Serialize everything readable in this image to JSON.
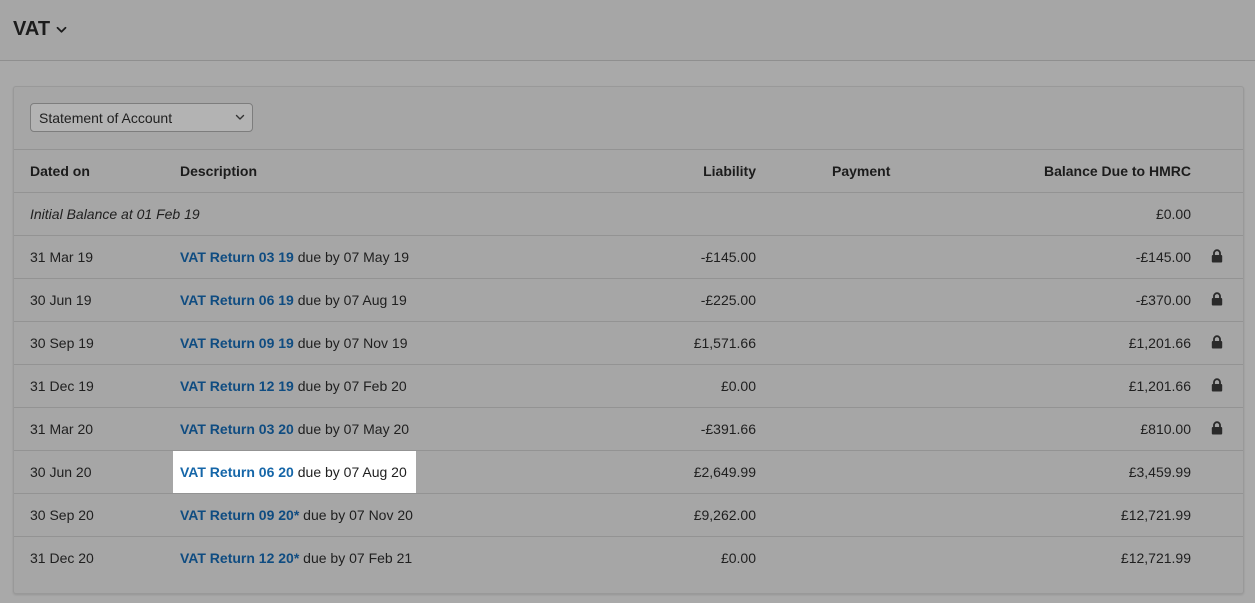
{
  "header": {
    "title": "VAT"
  },
  "filter": {
    "selected": "Statement of Account"
  },
  "table": {
    "columns": {
      "date": "Dated on",
      "description": "Description",
      "liability": "Liability",
      "payment": "Payment",
      "balance": "Balance Due to HMRC"
    },
    "initial": {
      "label": "Initial Balance at 01 Feb 19",
      "balance": "£0.00"
    },
    "rows": [
      {
        "date": "31 Mar 19",
        "link": "VAT Return 03 19",
        "due": " due by 07 May 19",
        "liability": "-£145.00",
        "payment": "",
        "balance": "-£145.00",
        "locked": true
      },
      {
        "date": "30 Jun 19",
        "link": "VAT Return 06 19",
        "due": " due by 07 Aug 19",
        "liability": "-£225.00",
        "payment": "",
        "balance": "-£370.00",
        "locked": true
      },
      {
        "date": "30 Sep 19",
        "link": "VAT Return 09 19",
        "due": " due by 07 Nov 19",
        "liability": "£1,571.66",
        "payment": "",
        "balance": "£1,201.66",
        "locked": true
      },
      {
        "date": "31 Dec 19",
        "link": "VAT Return 12 19",
        "due": " due by 07 Feb 20",
        "liability": "£0.00",
        "payment": "",
        "balance": "£1,201.66",
        "locked": true
      },
      {
        "date": "31 Mar 20",
        "link": "VAT Return 03 20",
        "due": " due by 07 May 20",
        "liability": "-£391.66",
        "payment": "",
        "balance": "£810.00",
        "locked": true
      },
      {
        "date": "30 Jun 20",
        "link": "VAT Return 06 20",
        "due": " due by 07 Aug 20",
        "liability": "£2,649.99",
        "payment": "",
        "balance": "£3,459.99",
        "locked": false
      },
      {
        "date": "30 Sep 20",
        "link": "VAT Return 09 20*",
        "due": " due by 07 Nov 20",
        "liability": "£9,262.00",
        "payment": "",
        "balance": "£12,721.99",
        "locked": false
      },
      {
        "date": "31 Dec 20",
        "link": "VAT Return 12 20*",
        "due": " due by 07 Feb 21",
        "liability": "£0.00",
        "payment": "",
        "balance": "£12,721.99",
        "locked": false
      }
    ]
  },
  "icons": {
    "lock": "lock-icon",
    "dropdown": "chevron-down-icon"
  },
  "colors": {
    "link": "#0f4c81",
    "highlight": "#ffffff"
  }
}
